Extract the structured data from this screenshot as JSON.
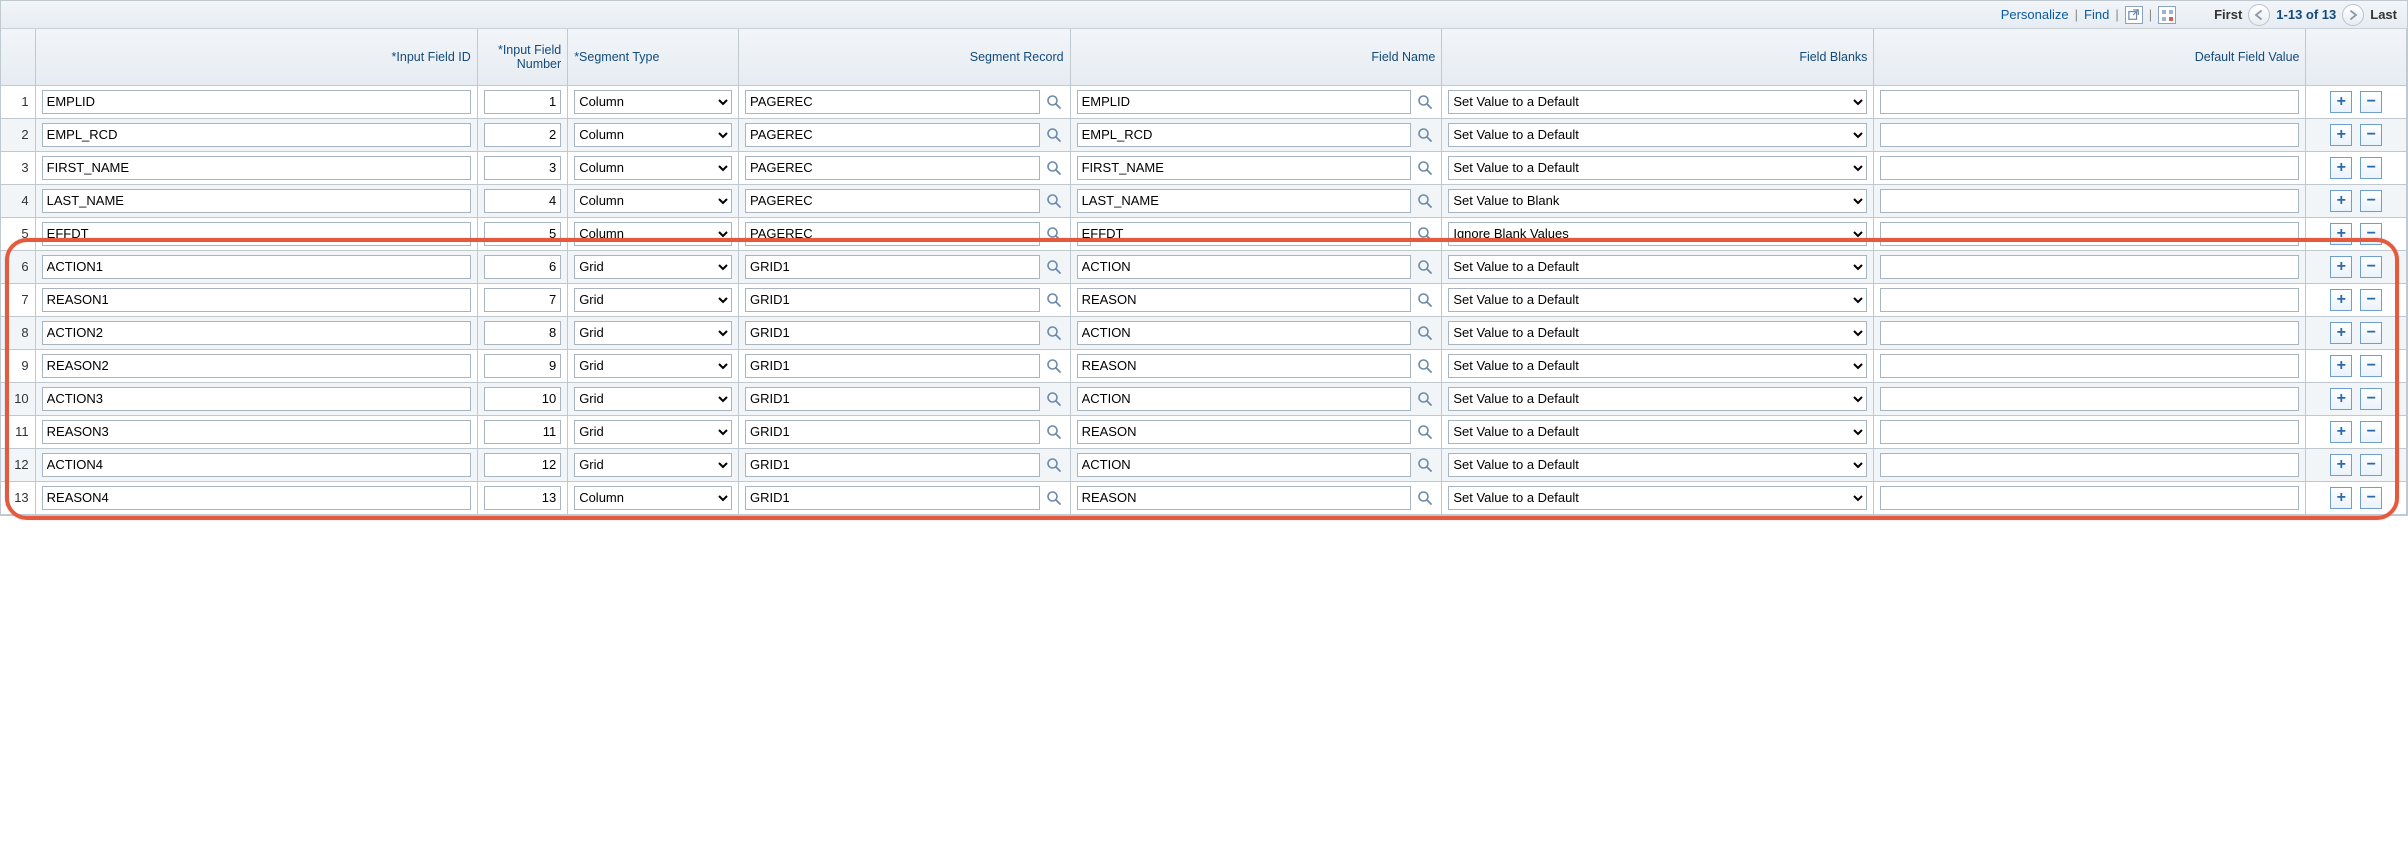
{
  "toolbar": {
    "personalize": "Personalize",
    "find": "Find",
    "first": "First",
    "last": "Last",
    "range": "1-13 of 13"
  },
  "columns": {
    "rownum": "",
    "input_field_id": "*Input Field ID",
    "input_field_number": "*Input Field Number",
    "segment_type": "*Segment Type",
    "segment_record": "Segment Record",
    "field_name": "Field Name",
    "field_blanks": "Field Blanks",
    "default_field_value": "Default Field Value",
    "actions": ""
  },
  "segment_type_options": [
    "Column",
    "Grid"
  ],
  "field_blanks_options": [
    "Set Value to a Default",
    "Set Value to Blank",
    "Ignore Blank Values"
  ],
  "rows": [
    {
      "n": "1",
      "id": "EMPLID",
      "num": "1",
      "seg": "Column",
      "rec": "PAGEREC",
      "fld": "EMPLID",
      "blk": "Set Value to a Default",
      "def": ""
    },
    {
      "n": "2",
      "id": "EMPL_RCD",
      "num": "2",
      "seg": "Column",
      "rec": "PAGEREC",
      "fld": "EMPL_RCD",
      "blk": "Set Value to a Default",
      "def": ""
    },
    {
      "n": "3",
      "id": "FIRST_NAME",
      "num": "3",
      "seg": "Column",
      "rec": "PAGEREC",
      "fld": "FIRST_NAME",
      "blk": "Set Value to a Default",
      "def": ""
    },
    {
      "n": "4",
      "id": "LAST_NAME",
      "num": "4",
      "seg": "Column",
      "rec": "PAGEREC",
      "fld": "LAST_NAME",
      "blk": "Set Value to Blank",
      "def": ""
    },
    {
      "n": "5",
      "id": "EFFDT",
      "num": "5",
      "seg": "Column",
      "rec": "PAGEREC",
      "fld": "EFFDT",
      "blk": "Ignore Blank Values",
      "def": ""
    },
    {
      "n": "6",
      "id": "ACTION1",
      "num": "6",
      "seg": "Grid",
      "rec": "GRID1",
      "fld": "ACTION",
      "blk": "Set Value to a Default",
      "def": ""
    },
    {
      "n": "7",
      "id": "REASON1",
      "num": "7",
      "seg": "Grid",
      "rec": "GRID1",
      "fld": "REASON",
      "blk": "Set Value to a Default",
      "def": ""
    },
    {
      "n": "8",
      "id": "ACTION2",
      "num": "8",
      "seg": "Grid",
      "rec": "GRID1",
      "fld": "ACTION",
      "blk": "Set Value to a Default",
      "def": ""
    },
    {
      "n": "9",
      "id": "REASON2",
      "num": "9",
      "seg": "Grid",
      "rec": "GRID1",
      "fld": "REASON",
      "blk": "Set Value to a Default",
      "def": ""
    },
    {
      "n": "10",
      "id": "ACTION3",
      "num": "10",
      "seg": "Grid",
      "rec": "GRID1",
      "fld": "ACTION",
      "blk": "Set Value to a Default",
      "def": ""
    },
    {
      "n": "11",
      "id": "REASON3",
      "num": "11",
      "seg": "Grid",
      "rec": "GRID1",
      "fld": "REASON",
      "blk": "Set Value to a Default",
      "def": ""
    },
    {
      "n": "12",
      "id": "ACTION4",
      "num": "12",
      "seg": "Grid",
      "rec": "GRID1",
      "fld": "ACTION",
      "blk": "Set Value to a Default",
      "def": ""
    },
    {
      "n": "13",
      "id": "REASON4",
      "num": "13",
      "seg": "Column",
      "rec": "GRID1",
      "fld": "REASON",
      "blk": "Set Value to a Default",
      "def": ""
    }
  ],
  "highlight": {
    "start_row_index": 5,
    "end_row_index": 12
  }
}
